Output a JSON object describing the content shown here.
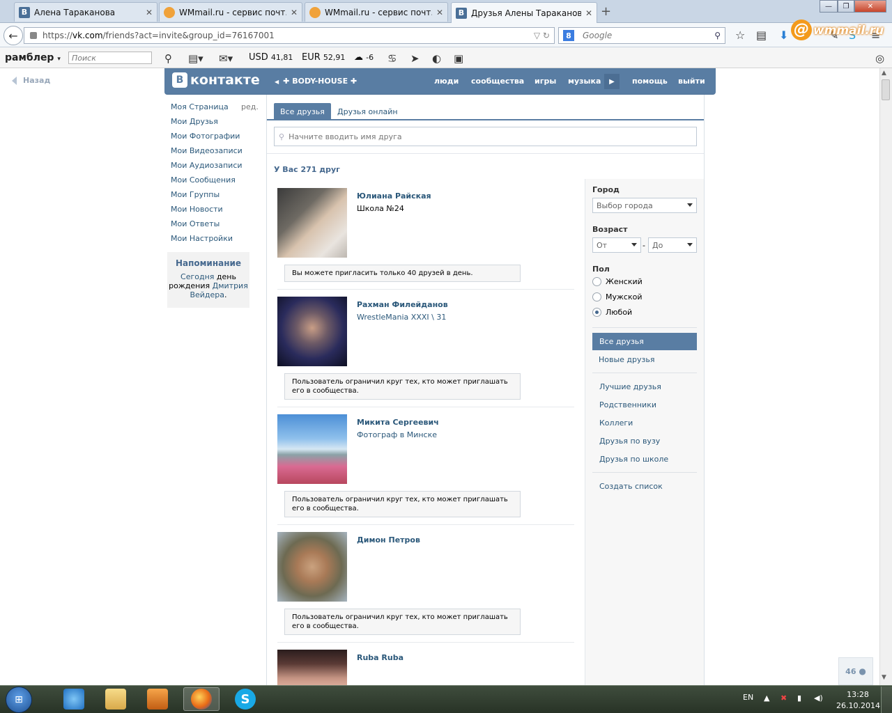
{
  "browser": {
    "tabs": [
      {
        "title": "Алена Тараканова",
        "icon": "vk-favicon"
      },
      {
        "title": "WMmail.ru - сервис почт...",
        "icon": "wmmail-favicon"
      },
      {
        "title": "WMmail.ru - сервис почт...",
        "icon": "wmmail-favicon"
      },
      {
        "title": "Друзья Алены Тараканов...",
        "icon": "vk-favicon",
        "active": true
      }
    ],
    "new_tab": "+",
    "close_glyph": "✕",
    "url_prefix": "https://",
    "url_domain": "vk.com",
    "url_path": "/friends?act=invite&group_id=76167001",
    "search_engine_letter": "8",
    "search_placeholder": "Google",
    "wmmail_logo": "wmmail.ru",
    "wmmail_at": "@"
  },
  "rambler": {
    "logo": "рамблер",
    "search_placeholder": "Поиск",
    "usd_label": "USD",
    "usd_value": "41,81",
    "eur_label": "EUR",
    "eur_value": "52,91",
    "weather": "-6"
  },
  "vk": {
    "back": "Назад",
    "logo_letter": "В",
    "logo_text": "контакте",
    "group_link": "✚ BODY-HOUSE ✚",
    "nav": [
      "люди",
      "сообщества",
      "игры",
      "музыка",
      "помощь",
      "выйти"
    ],
    "left_menu": [
      "Моя Страница",
      "Мои Друзья",
      "Мои Фотографии",
      "Мои Видеозаписи",
      "Мои Аудиозаписи",
      "Мои Сообщения",
      "Мои Группы",
      "Мои Новости",
      "Мои Ответы",
      "Мои Настройки"
    ],
    "edit": "ред.",
    "reminder": {
      "title": "Напоминание",
      "today": "Сегодня",
      "day": " день",
      "birth": "рождения ",
      "name1": "Дмитрия",
      "name2": "Вейдера",
      "dot": "."
    },
    "tabs": {
      "all": "Все друзья",
      "online": "Друзья онлайн"
    },
    "search_placeholder": "Начните вводить имя друга",
    "friend_count": "У Вас 271 друг",
    "friends": [
      {
        "name": "Юлиана Райская",
        "sub": "Школа №24",
        "note": "Вы можете пригласить только 40 друзей в день."
      },
      {
        "name": "Рахман Филейданов",
        "sub": "WrestleMania XXXI \\ 31",
        "note": "Пользователь ограничил круг тех, кто может приглашать его в сообщества."
      },
      {
        "name": "Микита Сергеевич",
        "sub": "Фотограф в Минске",
        "note": "Пользователь ограничил круг тех, кто может приглашать его в сообщества."
      },
      {
        "name": "Димон Петров",
        "sub": "",
        "note": "Пользователь ограничил круг тех, кто может приглашать его в сообщества."
      },
      {
        "name": "Ruba Ruba",
        "sub": "",
        "note": ""
      }
    ],
    "filters": {
      "city_label": "Город",
      "city_value": "Выбор города",
      "age_label": "Возраст",
      "age_from": "От",
      "age_to": "До",
      "age_dash": "-",
      "gender_label": "Пол",
      "gender_options": [
        "Женский",
        "Мужской",
        "Любой"
      ],
      "gender_selected": 2,
      "lists_active": "Все друзья",
      "lists_new": "Новые друзья",
      "lists": [
        "Лучшие друзья",
        "Родственники",
        "Коллеги",
        "Друзья по вузу",
        "Друзья по школе"
      ],
      "create_list": "Создать список"
    },
    "counter": "46"
  },
  "taskbar": {
    "lang": "EN",
    "time": "13:28",
    "date": "26.10.2014"
  },
  "colors": {
    "vk_blue": "#597da3",
    "vk_link": "#2b587a"
  }
}
